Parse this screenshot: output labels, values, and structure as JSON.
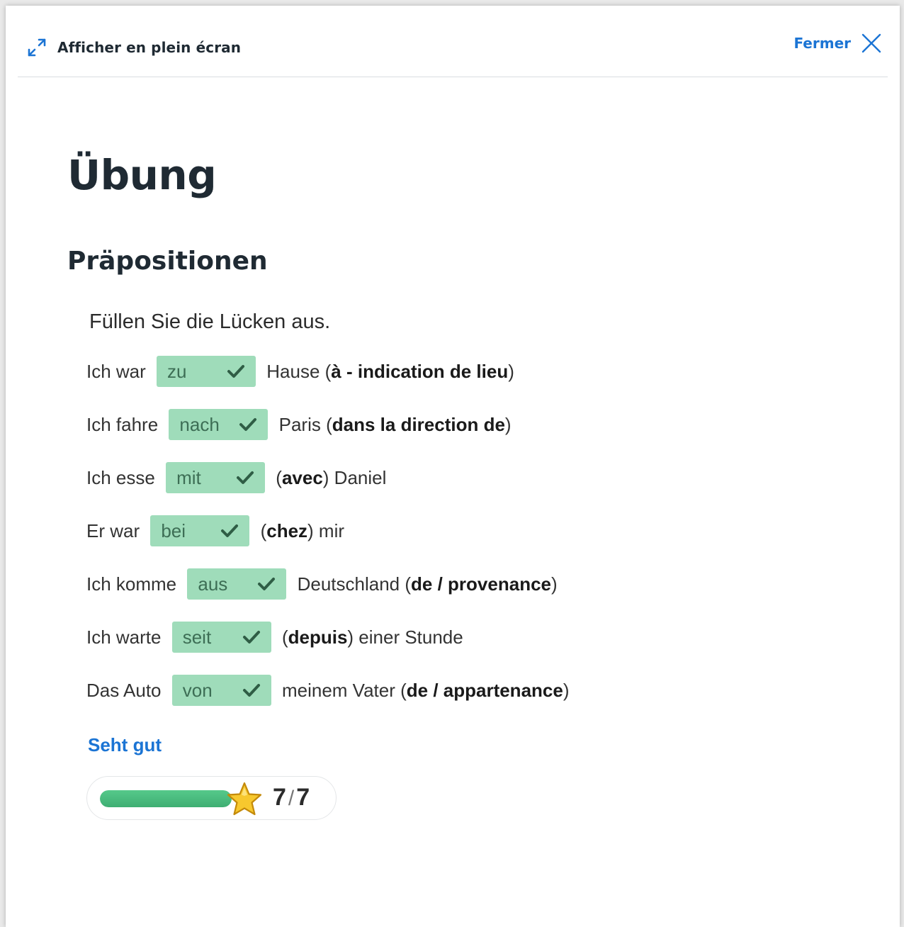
{
  "header": {
    "fullscreen_label": "Afficher en plein écran",
    "close_label": "Fermer"
  },
  "title": "Übung",
  "subtitle": "Präpositionen",
  "instruction": "Füllen Sie die Lücken aus.",
  "rows": [
    {
      "before": "Ich war ",
      "answer": "zu",
      "after_pre": " Hause (",
      "after_bold": "à - indication de lieu",
      "after_post": ")"
    },
    {
      "before": "Ich fahre ",
      "answer": "nach",
      "after_pre": " Paris (",
      "after_bold": "dans la direction de",
      "after_post": ")"
    },
    {
      "before": "Ich esse ",
      "answer": "mit",
      "after_pre": " (",
      "after_bold": "avec",
      "after_post": ") Daniel"
    },
    {
      "before": "Er war ",
      "answer": "bei",
      "after_pre": " (",
      "after_bold": "chez",
      "after_post": ") mir"
    },
    {
      "before": "Ich komme ",
      "answer": "aus",
      "after_pre": " Deutschland (",
      "after_bold": "de / provenance",
      "after_post": ")"
    },
    {
      "before": "Ich warte ",
      "answer": "seit",
      "after_pre": " (",
      "after_bold": "depuis",
      "after_post": ") einer Stunde"
    },
    {
      "before": "Das Auto ",
      "answer": "von",
      "after_pre": " meinem Vater (",
      "after_bold": "de / appartenance",
      "after_post": ")"
    }
  ],
  "feedback": "Seht gut",
  "score": {
    "correct": "7",
    "separator": "/",
    "total": "7",
    "progress_fraction": 1.0
  },
  "colors": {
    "accent": "#1b74d4",
    "answer_bg": "#9fdcba",
    "check": "#2f5d45",
    "progress": "#4cbf80",
    "star": "#f7c82e"
  },
  "icons": {
    "fullscreen": "expand-arrows-icon",
    "close": "close-x-icon",
    "check": "checkmark-icon",
    "star": "star-icon"
  }
}
